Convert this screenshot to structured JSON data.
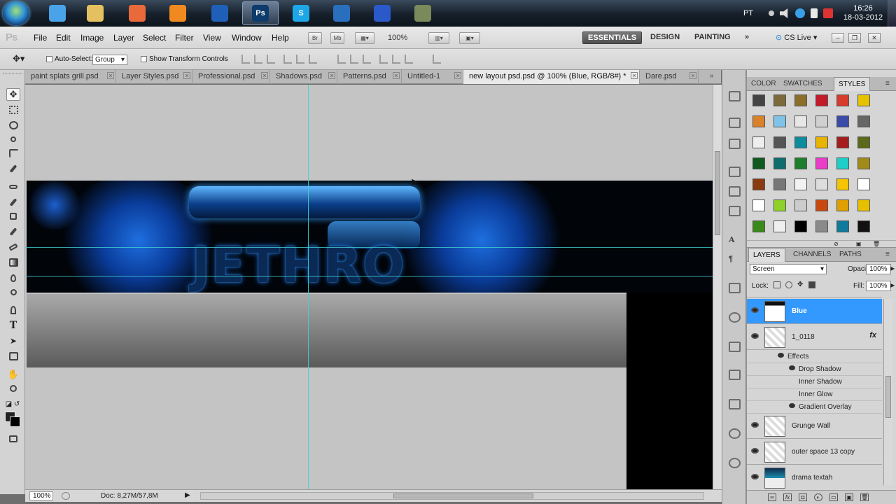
{
  "taskbar": {
    "language": "PT",
    "time": "16:26",
    "date": "18-03-2012",
    "apps": [
      {
        "name": "windows-explorer-icon",
        "glyph": "",
        "color": "#4aa3e8"
      },
      {
        "name": "folder-icon",
        "glyph": "",
        "color": "#e4c060"
      },
      {
        "name": "paint-icon",
        "glyph": "",
        "color": "#e86a3a"
      },
      {
        "name": "media-player-icon",
        "glyph": "",
        "color": "#f08a20"
      },
      {
        "name": "browser-icon",
        "glyph": "",
        "color": "#1f5fb8"
      },
      {
        "name": "photoshop-icon",
        "glyph": "Ps",
        "color": "#0d3b6b"
      },
      {
        "name": "skype-icon",
        "glyph": "S",
        "color": "#1ea7e8"
      },
      {
        "name": "illustrator-icon",
        "glyph": "",
        "color": "#2a6fbd"
      },
      {
        "name": "blue-app-icon",
        "glyph": "",
        "color": "#2a59c9"
      },
      {
        "name": "camera-icon",
        "glyph": "",
        "color": "#7a8a5a"
      }
    ]
  },
  "menubar": {
    "logo": "Ps",
    "items": [
      "File",
      "Edit",
      "Image",
      "Layer",
      "Select",
      "Filter",
      "View",
      "Window",
      "Help"
    ],
    "zoom": "100%",
    "workspaces": [
      "ESSENTIALS",
      "DESIGN",
      "PAINTING"
    ],
    "more": "»",
    "cslive": "CS Live"
  },
  "options": {
    "auto_select_label": "Auto-Select:",
    "auto_select_value": "Group",
    "transform_label": "Show Transform Controls"
  },
  "tabs": [
    "paint splats grill.psd",
    "Layer Styles.psd",
    "Professional.psd",
    "Shadows.psd",
    "Patterns.psd",
    "Untitled-1",
    "new layout psd.psd @ 100% (Blue, RGB/8#) *",
    "Dare.psd"
  ],
  "canvas": {
    "wordmark": "JETHRO"
  },
  "status": {
    "zoom": "100%",
    "doc": "Doc: 8,27M/57,8M"
  },
  "styles_panel": {
    "tabs": [
      "COLOR",
      "SWATCHES",
      "STYLES"
    ],
    "swatches": [
      "#444444",
      "#7d6a3a",
      "#8a6e2a",
      "#c41b2a",
      "#d63b2b",
      "#e6c200",
      "#d9822b",
      "#7fc4e8",
      "#e7e7e7",
      "#d0d0d0",
      "#3a4ca8",
      "#666666",
      "#eeeeee",
      "#555555",
      "#0c8c9c",
      "#e8b400",
      "#a51e1e",
      "#5a6a1a",
      "#0f5a1f",
      "#0e6e6e",
      "#1e7e2e",
      "#e93cc8",
      "#1ccfc8",
      "#a08a1a",
      "#8a3a10",
      "#777777",
      "#f2f2f2",
      "#dddddd",
      "#f5c400",
      "#ffffff",
      "#ffffff",
      "#8fd12a",
      "#cccccc",
      "#c84a10",
      "#e0a000",
      "#e6c000",
      "#3a8a1a",
      "#efefef",
      "#000000",
      "#8a8a8a",
      "#0f7a9a",
      "#111111"
    ]
  },
  "layers_panel": {
    "tabs": [
      "LAYERS",
      "CHANNELS",
      "PATHS"
    ],
    "blend_mode": "Screen",
    "opacity_label": "Opacity:",
    "opacity": "100%",
    "lock_label": "Lock:",
    "fill_label": "Fill:",
    "fill": "100%",
    "layers": [
      {
        "name": "Blue",
        "selected": true,
        "fx": ""
      },
      {
        "name": "1_0118",
        "selected": false,
        "fx": "fx"
      }
    ],
    "effects_label": "Effects",
    "effects": [
      "Drop Shadow",
      "Inner Shadow",
      "Inner Glow",
      "Gradient Overlay"
    ],
    "lower_layers": [
      "Grunge Wall",
      "outer space 13 copy",
      "drama textah"
    ]
  }
}
